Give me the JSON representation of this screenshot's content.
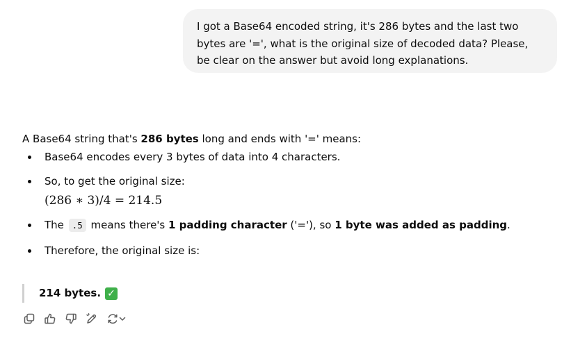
{
  "user_message": {
    "text": "I got a Base64 encoded string, it's 286 bytes and the last two bytes are '=', what is the original size of decoded data? Please, be clear on the answer but avoid long explanations."
  },
  "assistant_message": {
    "intro": {
      "before": "A Base64 string that's ",
      "bold": "286 bytes",
      "after": " long and ends with '=' means:"
    },
    "bullets": {
      "b1": "Base64 encodes every 3 bytes of data into 4 characters.",
      "b2": "So, to get the original size:",
      "formula": "(286 ∗ 3)/4 = 214.5",
      "b3_before": "The ",
      "b3_code": ".5",
      "b3_mid": " means there's ",
      "b3_bold1": "1 padding character",
      "b3_mid2": " ('='), so ",
      "b3_bold2": "1 byte was added as padding",
      "b3_end": ".",
      "b4": "Therefore, the original size is:"
    },
    "answer": "214 bytes.",
    "answer_emoji": "✓"
  },
  "toolbar": {
    "icons": [
      "copy-icon",
      "thumbs-up-icon",
      "thumbs-down-icon",
      "edit-icon",
      "regenerate-icon",
      "chevron-down-icon"
    ]
  },
  "colors": {
    "user_bubble_bg": "#f3f3f3",
    "text": "#0d0d0d",
    "icon": "#5d5d5d",
    "check_green": "#3fb04a",
    "quote_bar": "#d0d0d0"
  }
}
